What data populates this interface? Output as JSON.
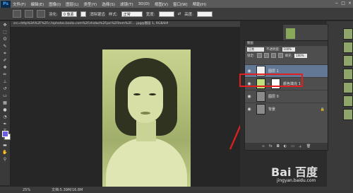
{
  "app": {
    "logo": "Ps"
  },
  "menu": [
    "文件(F)",
    "编辑(E)",
    "图像(I)",
    "图层(L)",
    "类型(Y)",
    "选择(S)",
    "滤镜(T)",
    "3D(D)",
    "视图(V)",
    "窗口(W)",
    "帮助(H)"
  ],
  "window_controls": [
    "−",
    "□",
    "×"
  ],
  "options_bar": {
    "feather_label": "羽化:",
    "feather_value": "0 像素",
    "antialias_label": "消除锯齿",
    "style_label": "样式:",
    "style_value": "正常",
    "width_label": "宽度:",
    "height_label": "高度:"
  },
  "document": {
    "tab_title": "src=http%3A%2F%2Fc.hiphotos.baidu.com%2Fzhidao%2Fpic%2Fitem%2F... .jpg@图层 1, RGB/8#"
  },
  "status": {
    "zoom": "25%",
    "doc_size": "文档:5.39M/16.8M"
  },
  "layers_panel": {
    "title": "图层",
    "blend_mode": "正常",
    "opacity_label": "不透明度:",
    "opacity_value": "100%",
    "lock_label": "锁定:",
    "fill_label": "填充:",
    "fill_value": "100%",
    "layers": [
      {
        "name": "图层 1",
        "thumb": "#f2f2f2",
        "selected": true
      },
      {
        "name": "颜色填充 1",
        "thumb": "#bfe07a",
        "has_mask": true
      },
      {
        "name": "图层 0",
        "thumb": "#8b8b8b"
      },
      {
        "name": "背景",
        "thumb": "#8b8b8b",
        "locked": true
      }
    ]
  },
  "watermark": {
    "brand": "Bai 百度",
    "site": "jingyan.baidu.com"
  },
  "colors": {
    "foreground": "#6b5ce7",
    "background": "#ffffff",
    "highlight": "#e02020",
    "photo_tint": "#c8d28f"
  }
}
